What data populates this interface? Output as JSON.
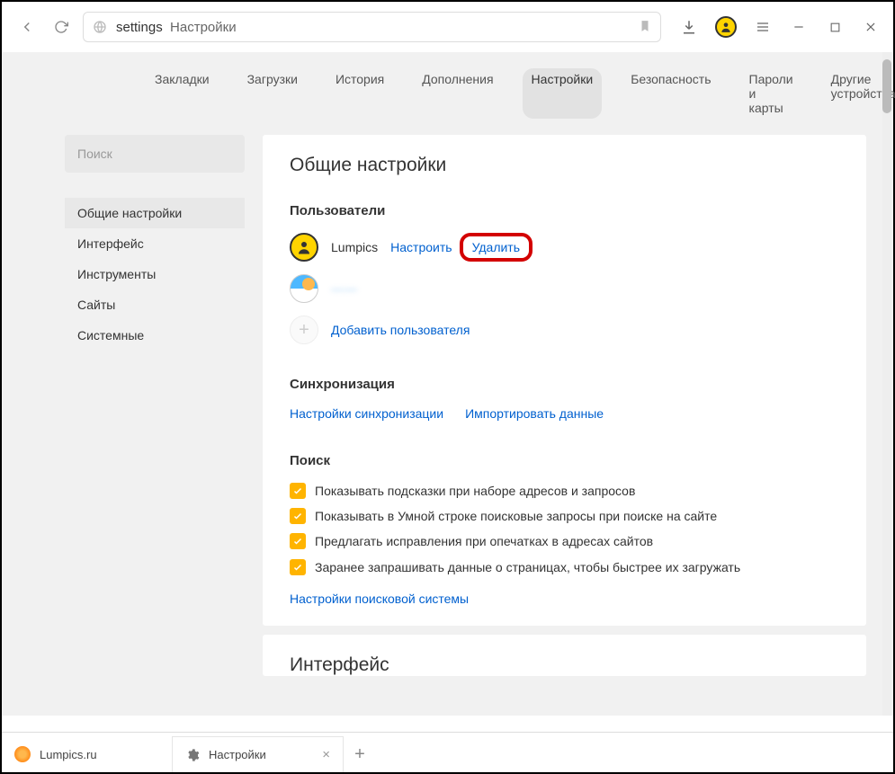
{
  "chrome": {
    "addr_protocol": "settings",
    "addr_title": "Настройки"
  },
  "topTabs": [
    "Закладки",
    "Загрузки",
    "История",
    "Дополнения",
    "Настройки",
    "Безопасность",
    "Пароли и карты",
    "Другие устройства"
  ],
  "topTabsActive": 4,
  "sidebar": {
    "search_placeholder": "Поиск",
    "items": [
      "Общие настройки",
      "Интерфейс",
      "Инструменты",
      "Сайты",
      "Системные"
    ],
    "active": 0
  },
  "panel": {
    "title": "Общие настройки",
    "users": {
      "heading": "Пользователи",
      "list": [
        {
          "name": "Lumpics",
          "configure": "Настроить",
          "delete": "Удалить"
        },
        {
          "name": "——"
        }
      ],
      "add": "Добавить пользователя"
    },
    "sync": {
      "heading": "Синхронизация",
      "links": [
        "Настройки синхронизации",
        "Импортировать данные"
      ]
    },
    "search": {
      "heading": "Поиск",
      "checks": [
        "Показывать подсказки при наборе адресов и запросов",
        "Показывать в Умной строке поисковые запросы при поиске на сайте",
        "Предлагать исправления при опечатках в адресах сайтов",
        "Заранее запрашивать данные о страницах, чтобы быстрее их загружать"
      ],
      "engine_link": "Настройки поисковой системы"
    }
  },
  "nextPanel": {
    "title": "Интерфейс"
  },
  "bottomTabs": {
    "tabs": [
      {
        "label": "Lumpics.ru"
      },
      {
        "label": "Настройки"
      }
    ]
  }
}
